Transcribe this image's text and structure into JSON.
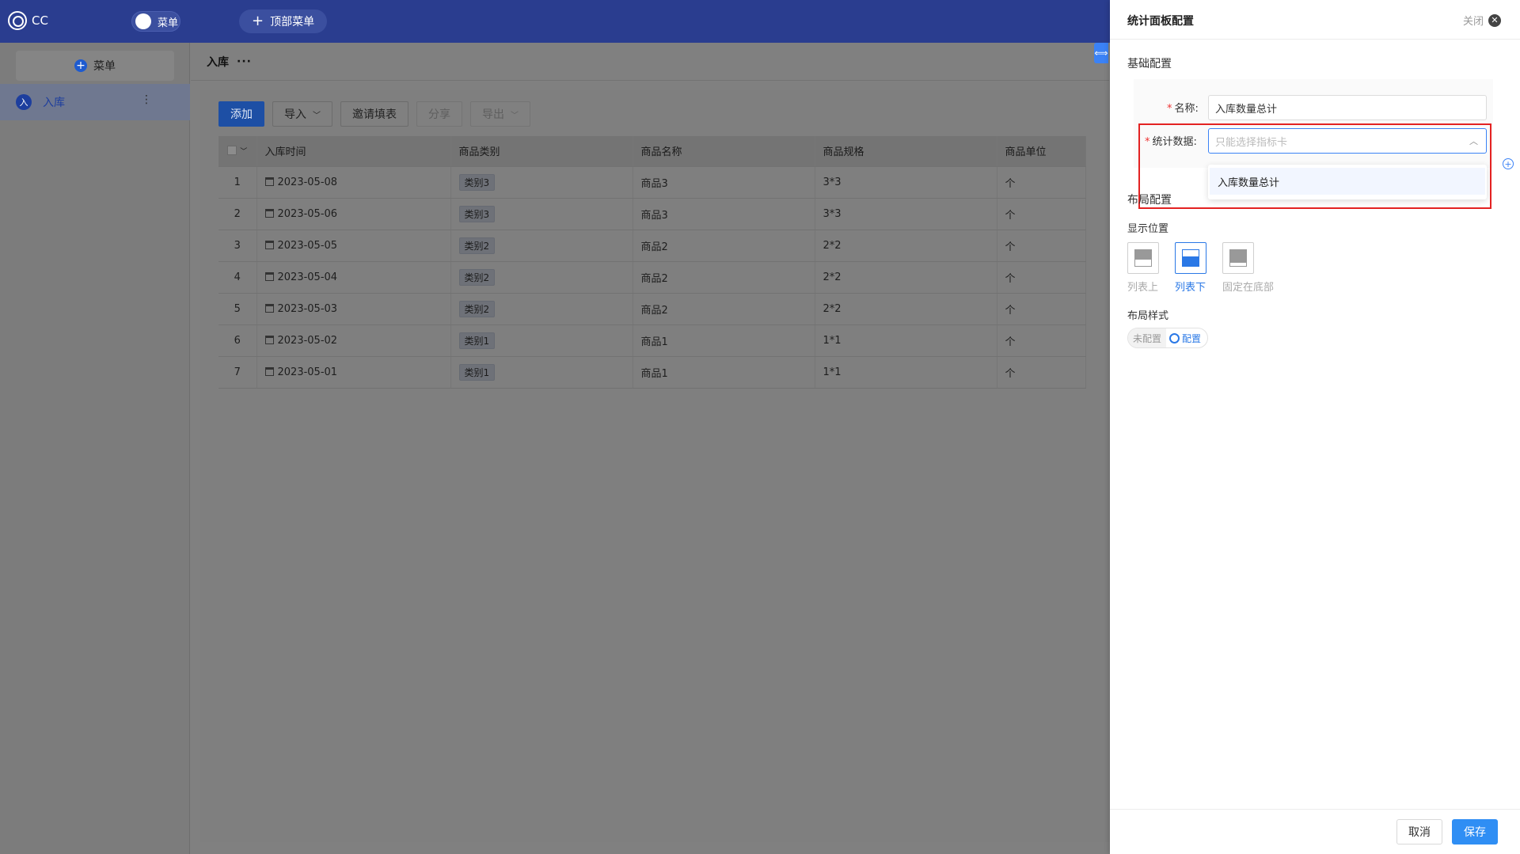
{
  "app": {
    "name": "CC"
  },
  "topbar": {
    "menu_toggle_label": "菜单",
    "top_menu_label": "顶部菜单"
  },
  "sidebar": {
    "add_label": "菜单",
    "items": [
      {
        "badge": "入",
        "label": "入库",
        "more": "⋮"
      }
    ]
  },
  "page": {
    "title": "入库",
    "more": "···"
  },
  "toolbar": {
    "add": "添加",
    "import": "导入",
    "invite": "邀请填表",
    "share": "分享",
    "export": "导出"
  },
  "table": {
    "columns": [
      "入库时间",
      "商品类别",
      "商品名称",
      "商品规格",
      "商品单位"
    ],
    "rows": [
      {
        "idx": "1",
        "date": "2023-05-08",
        "category": "类别3",
        "name": "商品3",
        "spec": "3*3",
        "unit": "个"
      },
      {
        "idx": "2",
        "date": "2023-05-06",
        "category": "类别3",
        "name": "商品3",
        "spec": "3*3",
        "unit": "个"
      },
      {
        "idx": "3",
        "date": "2023-05-05",
        "category": "类别2",
        "name": "商品2",
        "spec": "2*2",
        "unit": "个"
      },
      {
        "idx": "4",
        "date": "2023-05-04",
        "category": "类别2",
        "name": "商品2",
        "spec": "2*2",
        "unit": "个"
      },
      {
        "idx": "5",
        "date": "2023-05-03",
        "category": "类别2",
        "name": "商品2",
        "spec": "2*2",
        "unit": "个"
      },
      {
        "idx": "6",
        "date": "2023-05-02",
        "category": "类别1",
        "name": "商品1",
        "spec": "1*1",
        "unit": "个"
      },
      {
        "idx": "7",
        "date": "2023-05-01",
        "category": "类别1",
        "name": "商品1",
        "spec": "1*1",
        "unit": "个"
      }
    ]
  },
  "panel": {
    "title": "统计面板配置",
    "close": "关闭",
    "basic_section": "基础配置",
    "name_label": "名称:",
    "name_value": "入库数量总计",
    "stat_label": "统计数据:",
    "stat_placeholder": "只能选择指标卡",
    "dropdown_options": [
      "入库数量总计"
    ],
    "layout_section": "布局配置",
    "position_label": "显示位置",
    "positions": [
      {
        "label": "列表上",
        "selected": false
      },
      {
        "label": "列表下",
        "selected": true
      },
      {
        "label": "固定在底部",
        "selected": false
      }
    ],
    "layout_style_label": "布局样式",
    "layout_status": "未配置",
    "layout_config": "配置",
    "cancel": "取消",
    "save": "保存"
  },
  "colors": {
    "highlight": "#e32222",
    "primary": "#2f8ef4",
    "topbar": "#2a3d8f"
  }
}
